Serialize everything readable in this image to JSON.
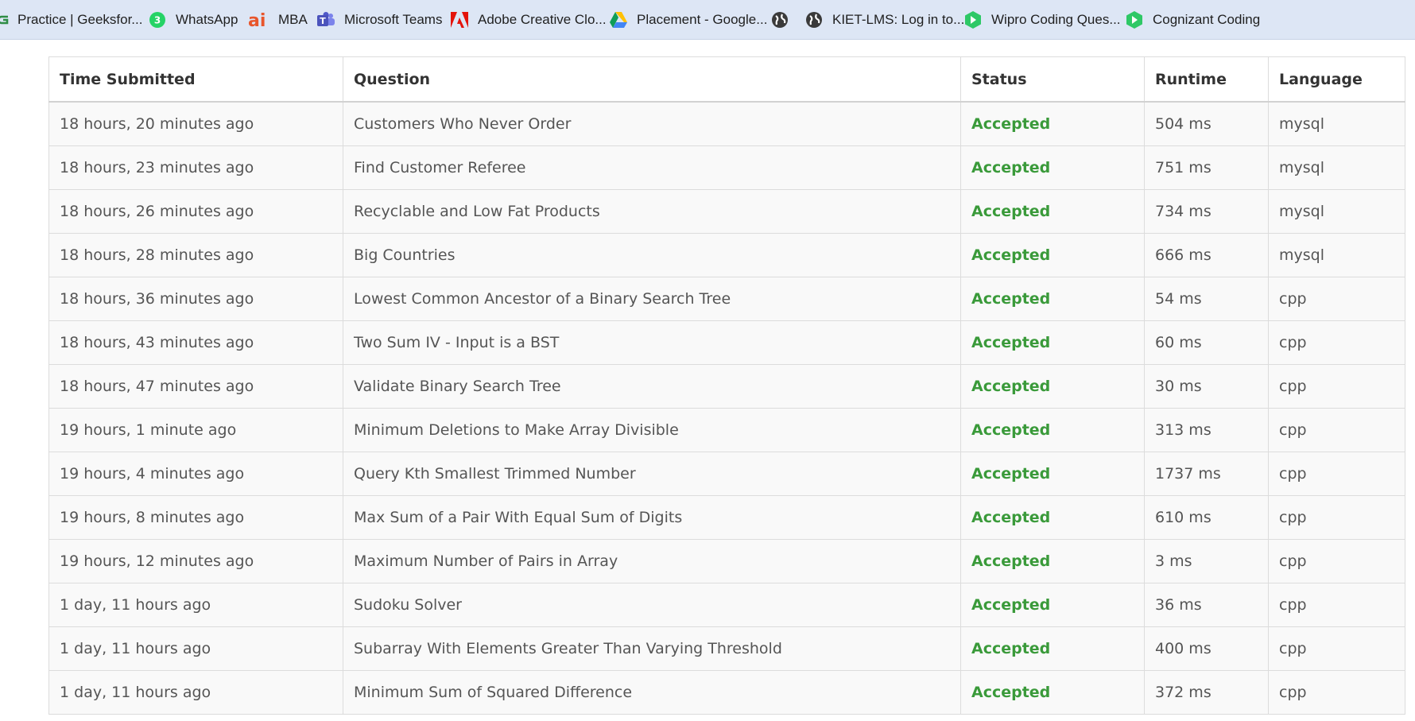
{
  "bookmarks": [
    {
      "label": "Practice | Geeksfor...",
      "icon": "geeksforgeeks-icon"
    },
    {
      "label": "WhatsApp",
      "icon": "whatsapp-icon"
    },
    {
      "label": "MBA",
      "icon": "ai-logo-icon"
    },
    {
      "label": "Microsoft Teams",
      "icon": "teams-icon"
    },
    {
      "label": "Adobe Creative Clo...",
      "icon": "adobe-icon"
    },
    {
      "label": "Placement - Google...",
      "icon": "google-drive-icon"
    },
    {
      "label": "",
      "icon": "globe-icon"
    },
    {
      "label": "KIET-LMS: Log in to...",
      "icon": "globe-icon"
    },
    {
      "label": "Wipro Coding Ques...",
      "icon": "hackerrank-icon"
    },
    {
      "label": "Cognizant Coding",
      "icon": "hackerrank-icon"
    }
  ],
  "table": {
    "headers": [
      "Time Submitted",
      "Question",
      "Status",
      "Runtime",
      "Language"
    ],
    "rows": [
      {
        "time": "18 hours, 20 minutes ago",
        "question": "Customers Who Never Order",
        "status": "Accepted",
        "runtime": "504 ms",
        "language": "mysql"
      },
      {
        "time": "18 hours, 23 minutes ago",
        "question": "Find Customer Referee",
        "status": "Accepted",
        "runtime": "751 ms",
        "language": "mysql"
      },
      {
        "time": "18 hours, 26 minutes ago",
        "question": "Recyclable and Low Fat Products",
        "status": "Accepted",
        "runtime": "734 ms",
        "language": "mysql"
      },
      {
        "time": "18 hours, 28 minutes ago",
        "question": "Big Countries",
        "status": "Accepted",
        "runtime": "666 ms",
        "language": "mysql"
      },
      {
        "time": "18 hours, 36 minutes ago",
        "question": "Lowest Common Ancestor of a Binary Search Tree",
        "status": "Accepted",
        "runtime": "54 ms",
        "language": "cpp"
      },
      {
        "time": "18 hours, 43 minutes ago",
        "question": "Two Sum IV - Input is a BST",
        "status": "Accepted",
        "runtime": "60 ms",
        "language": "cpp"
      },
      {
        "time": "18 hours, 47 minutes ago",
        "question": "Validate Binary Search Tree",
        "status": "Accepted",
        "runtime": "30 ms",
        "language": "cpp"
      },
      {
        "time": "19 hours, 1 minute ago",
        "question": "Minimum Deletions to Make Array Divisible",
        "status": "Accepted",
        "runtime": "313 ms",
        "language": "cpp"
      },
      {
        "time": "19 hours, 4 minutes ago",
        "question": "Query Kth Smallest Trimmed Number",
        "status": "Accepted",
        "runtime": "1737 ms",
        "language": "cpp"
      },
      {
        "time": "19 hours, 8 minutes ago",
        "question": "Max Sum of a Pair With Equal Sum of Digits",
        "status": "Accepted",
        "runtime": "610 ms",
        "language": "cpp"
      },
      {
        "time": "19 hours, 12 minutes ago",
        "question": "Maximum Number of Pairs in Array",
        "status": "Accepted",
        "runtime": "3 ms",
        "language": "cpp"
      },
      {
        "time": "1 day, 11 hours ago",
        "question": "Sudoku Solver",
        "status": "Accepted",
        "runtime": "36 ms",
        "language": "cpp"
      },
      {
        "time": "1 day, 11 hours ago",
        "question": "Subarray With Elements Greater Than Varying Threshold",
        "status": "Accepted",
        "runtime": "400 ms",
        "language": "cpp"
      },
      {
        "time": "1 day, 11 hours ago",
        "question": "Minimum Sum of Squared Difference",
        "status": "Accepted",
        "runtime": "372 ms",
        "language": "cpp"
      }
    ]
  },
  "colors": {
    "accepted": "#3a9a3a",
    "bookmark_bar": "#dde6f5"
  }
}
